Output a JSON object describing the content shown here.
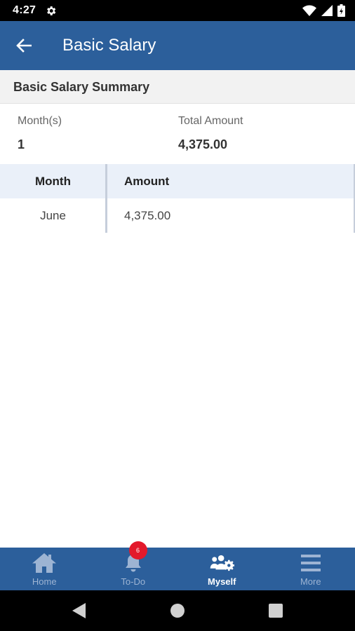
{
  "status_bar": {
    "time": "4:27"
  },
  "header": {
    "title": "Basic Salary"
  },
  "summary": {
    "heading": "Basic Salary Summary",
    "months_label": "Month(s)",
    "months_value": "1",
    "total_label": "Total Amount",
    "total_value": "4,375.00"
  },
  "table": {
    "columns": [
      "Month",
      "Amount"
    ],
    "rows": [
      {
        "month": "June",
        "amount": "4,375.00"
      }
    ]
  },
  "bottom_nav": {
    "items": [
      {
        "label": "Home",
        "icon": "home-icon"
      },
      {
        "label": "To-Do",
        "icon": "bell-icon",
        "badge": "6"
      },
      {
        "label": "Myself",
        "icon": "users-gear-icon",
        "active": true
      },
      {
        "label": "More",
        "icon": "menu-icon"
      }
    ]
  },
  "colors": {
    "primary": "#2c5f9b",
    "badge": "#e3192b",
    "table_header_bg": "#eaf0f9"
  }
}
